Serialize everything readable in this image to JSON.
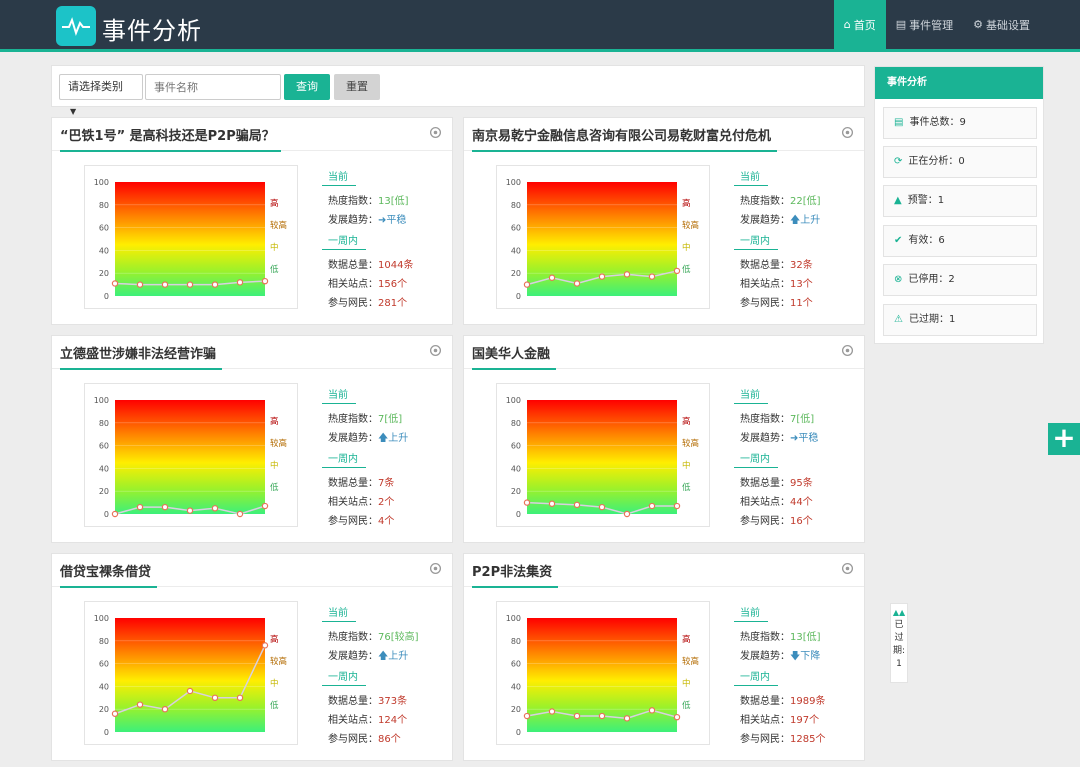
{
  "header": {
    "title": "事件分析",
    "nav": [
      {
        "label": "首页",
        "icon": "home-icon",
        "active": true
      },
      {
        "label": "事件管理",
        "icon": "document-icon",
        "active": false
      },
      {
        "label": "基础设置",
        "icon": "gear-icon",
        "active": false
      }
    ]
  },
  "search": {
    "category_label": "请选择类别",
    "name_placeholder": "事件名称",
    "query_label": "查询",
    "reset_label": "重置"
  },
  "labels": {
    "current": "当前",
    "heat": "热度指数：",
    "trend": "发展趋势：",
    "week": "一周内",
    "total": "数据总量：",
    "sites": "相关站点：",
    "users": "参与网民："
  },
  "chart_levels": [
    "高",
    "较高",
    "中",
    "低"
  ],
  "chart_ticks": [
    "100",
    "80",
    "60",
    "40",
    "20",
    "0"
  ],
  "cards": [
    {
      "title": "“巴铁1号” 是高科技还是P2P骗局？",
      "heat": "13[低]",
      "trend_arrow": "➜",
      "trend": "平稳",
      "total": "1044条",
      "sites": "156个",
      "users": "281个",
      "points": [
        11,
        10,
        10,
        10,
        10,
        12,
        13
      ]
    },
    {
      "title": "南京易乾宁金融信息咨询有限公司易乾财富兑付危机",
      "heat": "22[低]",
      "trend_arrow": "🡅",
      "trend": "上升",
      "total": "32条",
      "sites": "13个",
      "users": "11个",
      "points": [
        10,
        16,
        11,
        17,
        19,
        17,
        22
      ]
    },
    {
      "title": "立德盛世涉嫌非法经营诈骗",
      "heat": "7[低]",
      "trend_arrow": "🡅",
      "trend": "上升",
      "total": "7条",
      "sites": "2个",
      "users": "4个",
      "points": [
        0,
        6,
        6,
        3,
        5,
        0,
        7
      ]
    },
    {
      "title": "国美华人金融",
      "heat": "7[低]",
      "trend_arrow": "➜",
      "trend": "平稳",
      "total": "95条",
      "sites": "44个",
      "users": "16个",
      "points": [
        10,
        9,
        8,
        6,
        0,
        7,
        7
      ]
    },
    {
      "title": "借贷宝裸条借贷",
      "heat": "76[较高]",
      "trend_arrow": "🡅",
      "trend": "上升",
      "total": "373条",
      "sites": "124个",
      "users": "86个",
      "points": [
        16,
        24,
        20,
        36,
        30,
        30,
        76
      ]
    },
    {
      "title": "P2P非法集资",
      "heat": "13[低]",
      "trend_arrow": "🡇",
      "trend": "下降",
      "total": "1989条",
      "sites": "197个",
      "users": "1285个",
      "points": [
        14,
        18,
        14,
        14,
        12,
        19,
        13
      ]
    }
  ],
  "panel": {
    "title": "事件分析",
    "stats": [
      {
        "label": "事件总数：9",
        "icon": "list-icon"
      },
      {
        "label": "正在分析：0",
        "icon": "refresh-icon"
      },
      {
        "label": "预警：1",
        "icon": "bell-icon"
      },
      {
        "label": "有效：6",
        "icon": "check-circle-icon"
      },
      {
        "label": "已停用：2",
        "icon": "close-circle-icon"
      },
      {
        "label": "已过期：1",
        "icon": "warning-icon"
      }
    ]
  },
  "float_tab": {
    "chars": [
      "已",
      "过",
      "期:",
      "1"
    ]
  },
  "plus_label": "+"
}
